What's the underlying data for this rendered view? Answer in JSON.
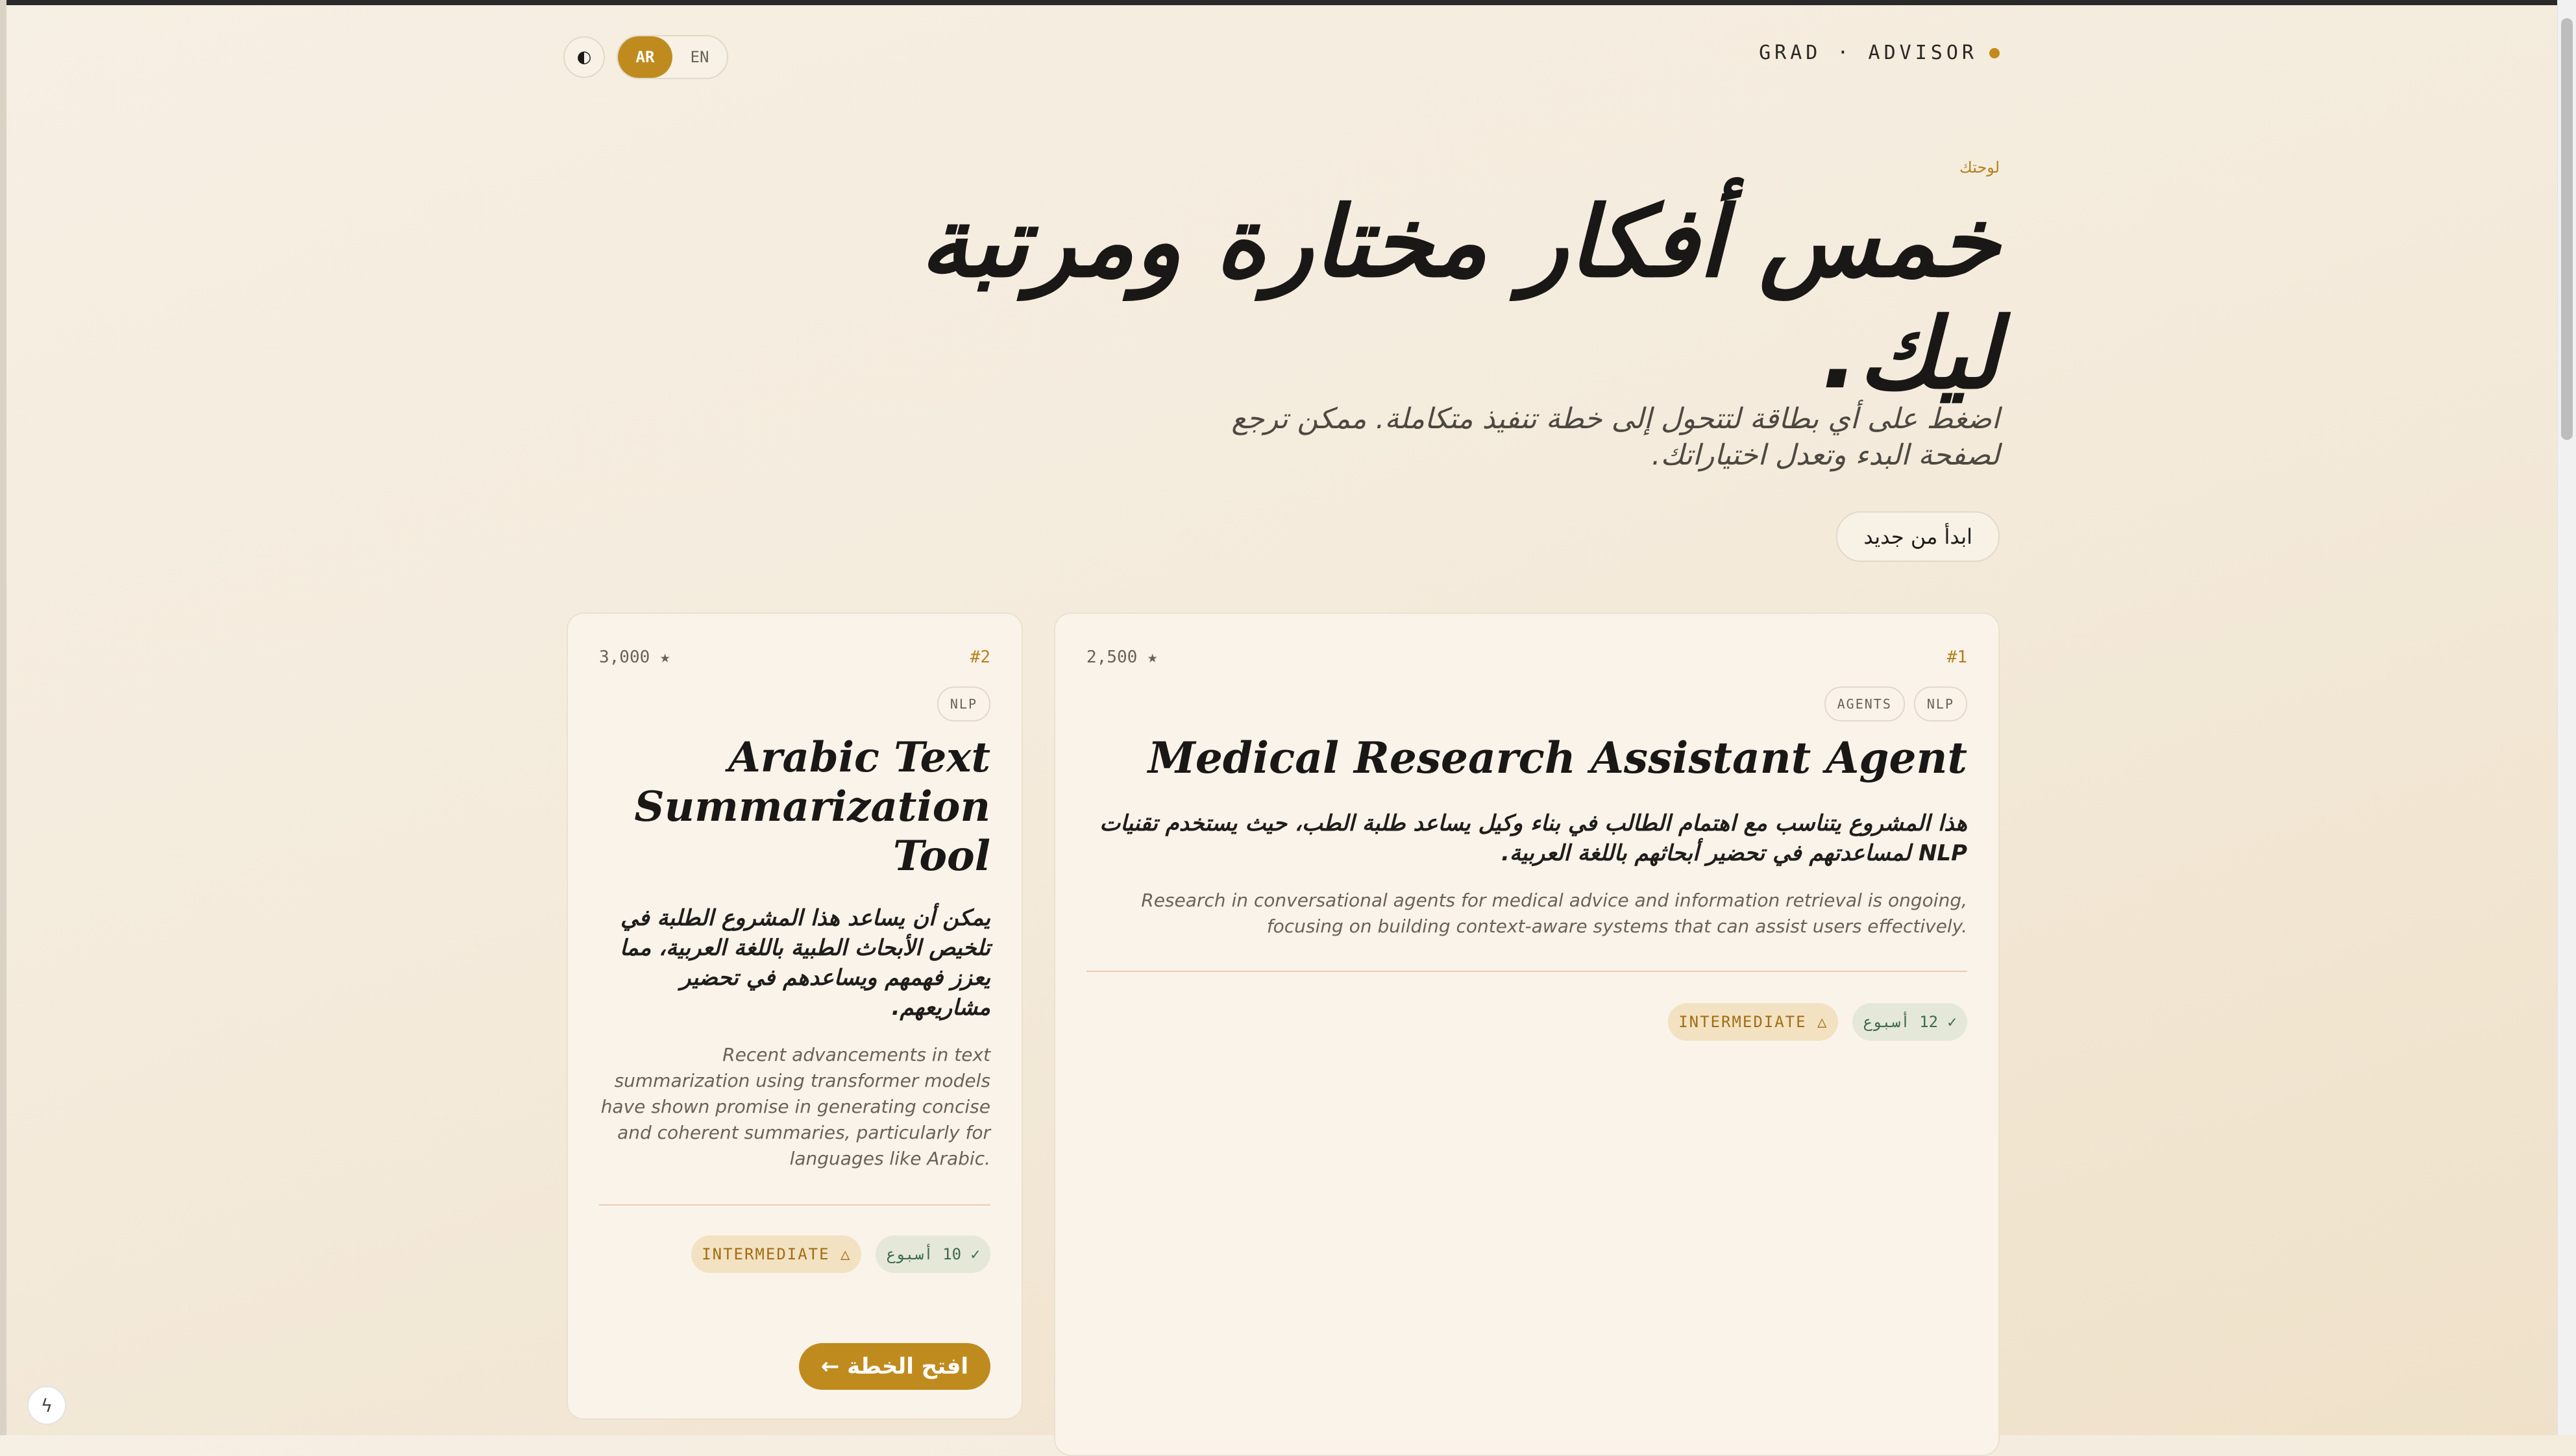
{
  "header": {
    "theme_toggle_icon": "◐",
    "lang_options": [
      "AR",
      "EN"
    ],
    "active_lang": "AR",
    "brand": "GRAD · ADVISOR"
  },
  "hero": {
    "kicker": "لوحتك",
    "title": "خمس أفكار مختارة ومرتبة ليك.",
    "subtitle": "اضغط على أي بطاقة لتتحول إلى خطة تنفيذ متكاملة. ممكن ترجع لصفحة البدء وتعدل اختياراتك.",
    "restart_label": "ابدأ من جديد"
  },
  "cards": [
    {
      "rank": "#1",
      "stars": "2,500 ★",
      "tags": [
        "NLP",
        "AGENTS"
      ],
      "title": "Medical Research Assistant Agent",
      "desc_ar": "هذا المشروع يتناسب مع اهتمام الطالب في بناء وكيل يساعد طلبة الطب، حيث يستخدم تقنيات NLP لمساعدتهم في تحضير أبحاثهم باللغة العربية.",
      "desc_en": "Research in conversational agents for medical advice and information retrieval is ongoing, focusing on building context-aware systems that can assist users effectively.",
      "weeks": "✓ 12 أسبوع",
      "level": "INTERMEDIATE △"
    },
    {
      "rank": "#2",
      "stars": "3,000 ★",
      "tags": [
        "NLP"
      ],
      "title": "Arabic Text Summarization Tool",
      "desc_ar": "يمكن أن يساعد هذا المشروع الطلبة في تلخيص الأبحاث الطبية باللغة العربية، مما يعزز فهمهم ويساعدهم في تحضير مشاريعهم.",
      "desc_en": "Recent advancements in text summarization using transformer models have shown promise in generating concise and coherent summaries, particularly for languages like Arabic.",
      "weeks": "✓ 10 أسبوع",
      "level": "INTERMEDIATE △",
      "open_label": "افتح الخطة ←"
    }
  ],
  "colors": {
    "accent": "#c08b1e",
    "background": "#f4ebdc",
    "card": "#f9f3ea"
  },
  "floating": {
    "bolt_icon": "ϟ"
  }
}
